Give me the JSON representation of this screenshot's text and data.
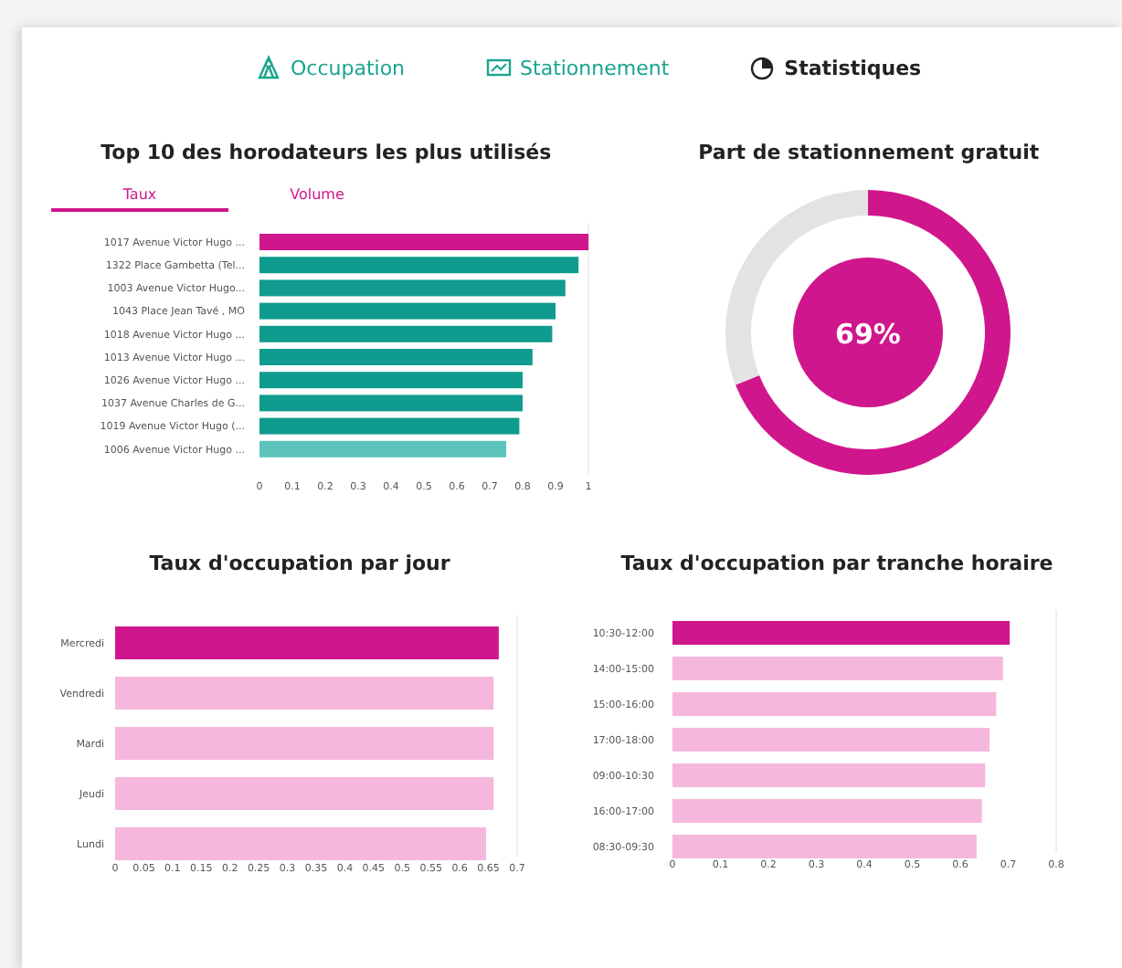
{
  "nav": [
    {
      "label": "Occupation",
      "selected": false
    },
    {
      "label": "Stationnement",
      "selected": false
    },
    {
      "label": "Statistiques",
      "selected": true
    }
  ],
  "top_chart": {
    "title": "Top 10 des horodateurs les plus utilisés",
    "toggle": [
      {
        "label": "Taux",
        "selected": true
      },
      {
        "label": "Volume",
        "selected": false
      }
    ],
    "chart_data": {
      "type": "bar",
      "orientation": "horizontal",
      "categories": [
        "1017 Avenue Victor Hugo ...",
        "1322 Place Gambetta (Tel...",
        "1003 Avenue Victor Hugo...",
        "1043 Place Jean Tavé , MO",
        "1018 Avenue Victor Hugo ...",
        "1013 Avenue Victor Hugo ...",
        "1026 Avenue Victor Hugo ...",
        "1037 Avenue Charles de G...",
        "1019 Avenue Victor Hugo (...",
        "1006 Avenue Victor Hugo ..."
      ],
      "values": [
        1.0,
        0.97,
        0.93,
        0.9,
        0.89,
        0.83,
        0.8,
        0.8,
        0.79,
        0.75
      ],
      "colors": [
        "#d0168c",
        "#0f9b8e",
        "#0f9b8e",
        "#0f9b8e",
        "#0f9b8e",
        "#0f9b8e",
        "#0f9b8e",
        "#0f9b8e",
        "#0f9b8e",
        "#5cc4bb"
      ],
      "xlim": [
        0,
        1
      ],
      "xticks": [
        0,
        0.1,
        0.2,
        0.3,
        0.4,
        0.5,
        0.6,
        0.7,
        0.8,
        0.9,
        1
      ]
    }
  },
  "free_parking": {
    "title": "Part de stationnement gratuit",
    "center_label": "69%",
    "chart_data": {
      "type": "donut",
      "values": [
        0.69,
        0.31
      ],
      "colors": [
        "#d0168c",
        "#e3e3e3"
      ]
    }
  },
  "day_chart": {
    "title": "Taux d'occupation par jour",
    "chart_data": {
      "type": "bar",
      "orientation": "horizontal",
      "categories": [
        "Mercredi",
        "Vendredi",
        "Mardi",
        "Jeudi",
        "Lundi"
      ],
      "values": [
        0.668,
        0.659,
        0.659,
        0.659,
        0.646
      ],
      "colors": [
        "#d0168c",
        "#f5b8dc",
        "#f5b8dc",
        "#f5b8dc",
        "#f5b8dc"
      ],
      "xlim": [
        0,
        0.7
      ],
      "xticks": [
        0,
        0.05,
        0.1,
        0.15,
        0.2,
        0.25,
        0.3,
        0.35,
        0.4,
        0.45,
        0.5,
        0.55,
        0.6,
        0.65,
        0.7
      ]
    }
  },
  "hour_chart": {
    "title": "Taux d'occupation par tranche horaire",
    "chart_data": {
      "type": "bar",
      "orientation": "horizontal",
      "categories": [
        "10:30-12:00",
        "14:00-15:00",
        "15:00-16:00",
        "17:00-18:00",
        "09:00-10:30",
        "16:00-17:00",
        "08:30-09:30"
      ],
      "values": [
        0.703,
        0.689,
        0.675,
        0.661,
        0.652,
        0.645,
        0.634
      ],
      "colors": [
        "#d0168c",
        "#f5b8dc",
        "#f5b8dc",
        "#f5b8dc",
        "#f5b8dc",
        "#f5b8dc",
        "#f5b8dc"
      ],
      "xlim": [
        0,
        0.8
      ],
      "xticks": [
        0,
        0.1,
        0.2,
        0.3,
        0.4,
        0.5,
        0.6,
        0.7,
        0.8
      ]
    }
  }
}
